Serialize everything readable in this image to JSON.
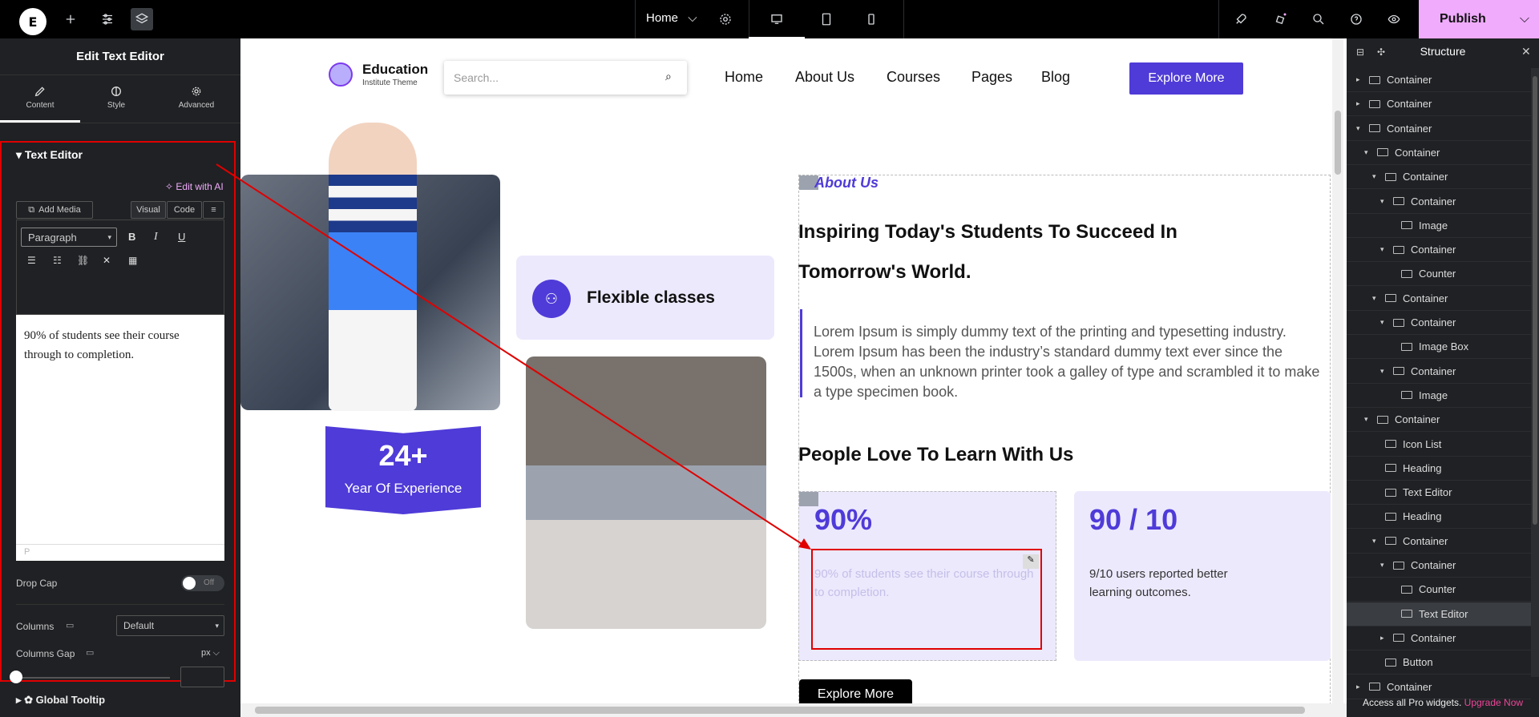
{
  "topbar": {
    "page_name": "Home",
    "publish_label": "Publish",
    "logo": "E"
  },
  "left_panel": {
    "title": "Edit Text Editor",
    "tabs": [
      {
        "label": "Content"
      },
      {
        "label": "Style"
      },
      {
        "label": "Advanced"
      }
    ],
    "section_title": "Text Editor",
    "edit_ai": "Edit with AI",
    "add_media": "Add Media",
    "visual_tab": "Visual",
    "code_tab": "Code",
    "format_select": "Paragraph",
    "content": "90% of students see their course through to completion.",
    "path_label": "P",
    "drop_cap_label": "Drop Cap",
    "drop_cap_value": "Off",
    "columns_label": "Columns",
    "columns_value": "Default",
    "columns_gap_label": "Columns Gap",
    "columns_gap_unit": "px",
    "global_tooltip": "Global Tooltip"
  },
  "site": {
    "brand_title": "Education",
    "brand_sub": "Institute Theme",
    "search_placeholder": "Search...",
    "nav": [
      {
        "label": "Home"
      },
      {
        "label": "About Us"
      },
      {
        "label": "Courses"
      },
      {
        "label": "Pages"
      },
      {
        "label": "Blog"
      }
    ],
    "cta": "Explore More",
    "flexible": "Flexible classes",
    "experience_value": "24+",
    "experience_label": "Year Of Experience",
    "about_tag": "About Us",
    "headline_1": "Inspiring Today's Students To Succeed In",
    "headline_2": "Tomorrow's World.",
    "lorem": "Lorem Ipsum is simply dummy text of the printing and typesetting industry. Lorem Ipsum has been the industry’s standard dummy text ever since the 1500s, when an unknown printer took a galley of type and scrambled it to make a type specimen book.",
    "people": "People Love To Learn With Us",
    "stat1_value": "90%",
    "stat1_text": "90% of students see their course through to completion.",
    "stat2_value": "90 / 10",
    "stat2_text": "9/10 users reported better learning outcomes.",
    "bottom_cta": "Explore More"
  },
  "structure": {
    "title": "Structure",
    "items": [
      {
        "label": "Container",
        "depth": 0,
        "arrow": "▸"
      },
      {
        "label": "Container",
        "depth": 0,
        "arrow": "▸"
      },
      {
        "label": "Container",
        "depth": 0,
        "arrow": "▾"
      },
      {
        "label": "Container",
        "depth": 1,
        "arrow": "▾"
      },
      {
        "label": "Container",
        "depth": 2,
        "arrow": "▾"
      },
      {
        "label": "Container",
        "depth": 3,
        "arrow": "▾"
      },
      {
        "label": "Image",
        "depth": 4,
        "arrow": ""
      },
      {
        "label": "Container",
        "depth": 3,
        "arrow": "▾"
      },
      {
        "label": "Counter",
        "depth": 4,
        "arrow": ""
      },
      {
        "label": "Container",
        "depth": 2,
        "arrow": "▾"
      },
      {
        "label": "Container",
        "depth": 3,
        "arrow": "▾"
      },
      {
        "label": "Image Box",
        "depth": 4,
        "arrow": ""
      },
      {
        "label": "Container",
        "depth": 3,
        "arrow": "▾"
      },
      {
        "label": "Image",
        "depth": 4,
        "arrow": ""
      },
      {
        "label": "Container",
        "depth": 1,
        "arrow": "▾"
      },
      {
        "label": "Icon List",
        "depth": 2,
        "arrow": ""
      },
      {
        "label": "Heading",
        "depth": 2,
        "arrow": ""
      },
      {
        "label": "Text Editor",
        "depth": 2,
        "arrow": ""
      },
      {
        "label": "Heading",
        "depth": 2,
        "arrow": ""
      },
      {
        "label": "Container",
        "depth": 2,
        "arrow": "▾"
      },
      {
        "label": "Container",
        "depth": 3,
        "arrow": "▾"
      },
      {
        "label": "Counter",
        "depth": 4,
        "arrow": ""
      },
      {
        "label": "Text Editor",
        "depth": 4,
        "arrow": ""
      },
      {
        "label": "Container",
        "depth": 3,
        "arrow": "▸"
      },
      {
        "label": "Button",
        "depth": 2,
        "arrow": ""
      },
      {
        "label": "Container",
        "depth": 0,
        "arrow": "▸"
      }
    ],
    "footer_text": "Access all Pro widgets.",
    "upgrade": "Upgrade Now"
  },
  "colors": {
    "accent": "#4f3bd8",
    "publish": "#f0abfc",
    "panel": "#1f2124",
    "highlight": "#e00000"
  }
}
